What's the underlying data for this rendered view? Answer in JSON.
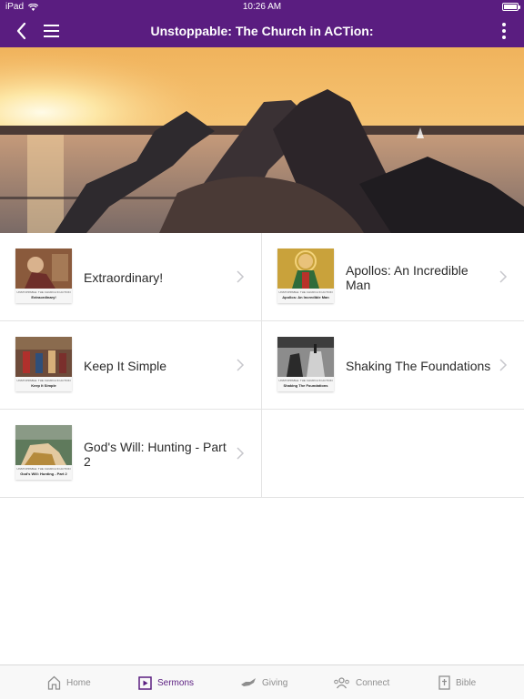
{
  "status_bar": {
    "carrier": "iPad",
    "time": "10:26 AM"
  },
  "nav": {
    "title": "Unstoppable: The Church in ACTion:"
  },
  "sermons": [
    {
      "title": "Extraordinary!",
      "thumb_series": "UNSTOPPABLE: THE CHURCH IN ACTION",
      "thumb_title": "Extraordinary!"
    },
    {
      "title": "Apollos: An Incredible Man",
      "thumb_series": "UNSTOPPABLE: THE CHURCH IN ACTION",
      "thumb_title": "Apollos: An Incredible Man"
    },
    {
      "title": "Keep It Simple",
      "thumb_series": "UNSTOPPABLE: THE CHURCH IN ACTION",
      "thumb_title": "Keep It Simple"
    },
    {
      "title": "Shaking The Foundations",
      "thumb_series": "UNSTOPPABLE: THE CHURCH IN ACTION",
      "thumb_title": "Shaking The Foundations"
    },
    {
      "title": "God's Will: Hunting - Part 2",
      "thumb_series": "UNSTOPPABLE: THE CHURCH IN ACTION",
      "thumb_title": "God's Will: Hunting - Part 2"
    }
  ],
  "tabs": [
    {
      "label": "Home",
      "icon": "home-icon"
    },
    {
      "label": "Sermons",
      "icon": "play-icon"
    },
    {
      "label": "Giving",
      "icon": "giving-icon"
    },
    {
      "label": "Connect",
      "icon": "people-icon"
    },
    {
      "label": "Bible",
      "icon": "bible-icon"
    }
  ],
  "colors": {
    "accent": "#5a1d80",
    "tab_inactive": "#8e8e8e"
  }
}
